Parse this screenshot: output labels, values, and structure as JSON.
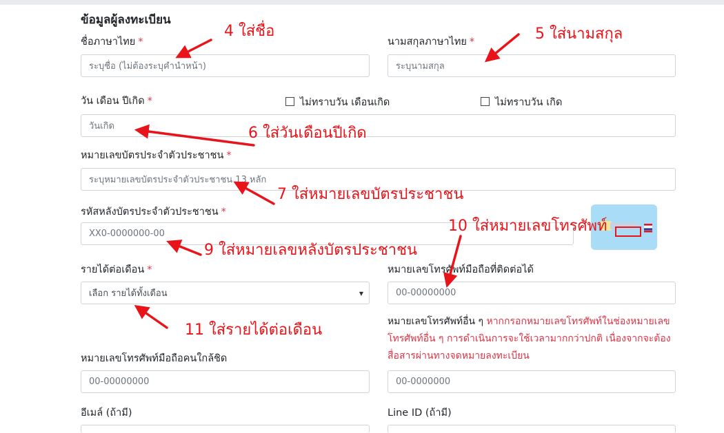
{
  "form": {
    "section_title": "ข้อมูลผู้ลงทะเบียน",
    "required_mark": "*",
    "first_name": {
      "label": "ชื่อภาษาไทย",
      "placeholder": "ระบุชื่อ (ไม่ต้องระบุคำนำหน้า)"
    },
    "last_name": {
      "label": "นามสกุลภาษาไทย",
      "placeholder": "ระบุนามสกุล"
    },
    "birth_date": {
      "label": "วัน เดือน ปีเกิด",
      "placeholder": "วันเกิด",
      "unknown_day_month": "ไม่ทราบวัน เดือนเกิด",
      "unknown_day": "ไม่ทราบวัน เกิด"
    },
    "id_card": {
      "label": "หมายเลขบัตรประจำตัวประชาชน",
      "placeholder": "ระบุหมายเลขบัตรประจำตัวประชาชน 13 หลัก"
    },
    "id_card_back": {
      "label": "รหัสหลังบัตรประจำตัวประชาชน",
      "placeholder": "XX0-0000000-00"
    },
    "income": {
      "label": "รายได้ต่อเดือน",
      "selected": "เลือก รายได้ทั้งเดือน"
    },
    "mobile": {
      "label": "หมายเลขโทรศัพท์มือถือที่ติดต่อได้",
      "placeholder": "00-00000000"
    },
    "other_phone": {
      "label": "หมายเลขโทรศัพท์อื่น ๆ",
      "note": "หากกรอกหมายเลขโทรศัพท์ในช่องหมายเลขโทรศัพท์อื่น ๆ การดำเนินการจะใช้เวลามากกว่าปกติ เนื่องจากจะต้องสื่อสารผ่านทางจดหมายลงทะเบียน",
      "placeholder": "00-0000000"
    },
    "close_contact": {
      "label": "หมายเลขโทรศัพท์มือถือคนใกล้ชิด",
      "placeholder": "00-00000000"
    },
    "email": {
      "label": "อีเมล์ (ถ้ามี)"
    },
    "line_id": {
      "label": "Line ID (ถ้ามี)"
    }
  },
  "annotations": {
    "a4": "4  ใส่ชื่อ",
    "a5": "5  ใส่นามสกุล",
    "a6": "6  ใส่วันเดือนปีเกิด",
    "a7": "7  ใส่หมายเลขบัตรประชาชน",
    "a9": "9  ใส่หมายเลขหลังบัตรประชาชน",
    "a10": "10  ใส่หมายเลขโทรศัพท์",
    "a11": "11  ใส่รายได้ต่อเดือน"
  },
  "colors": {
    "annotation": "#e8141a",
    "required": "#dc3545",
    "card": "#a9dcf6"
  }
}
